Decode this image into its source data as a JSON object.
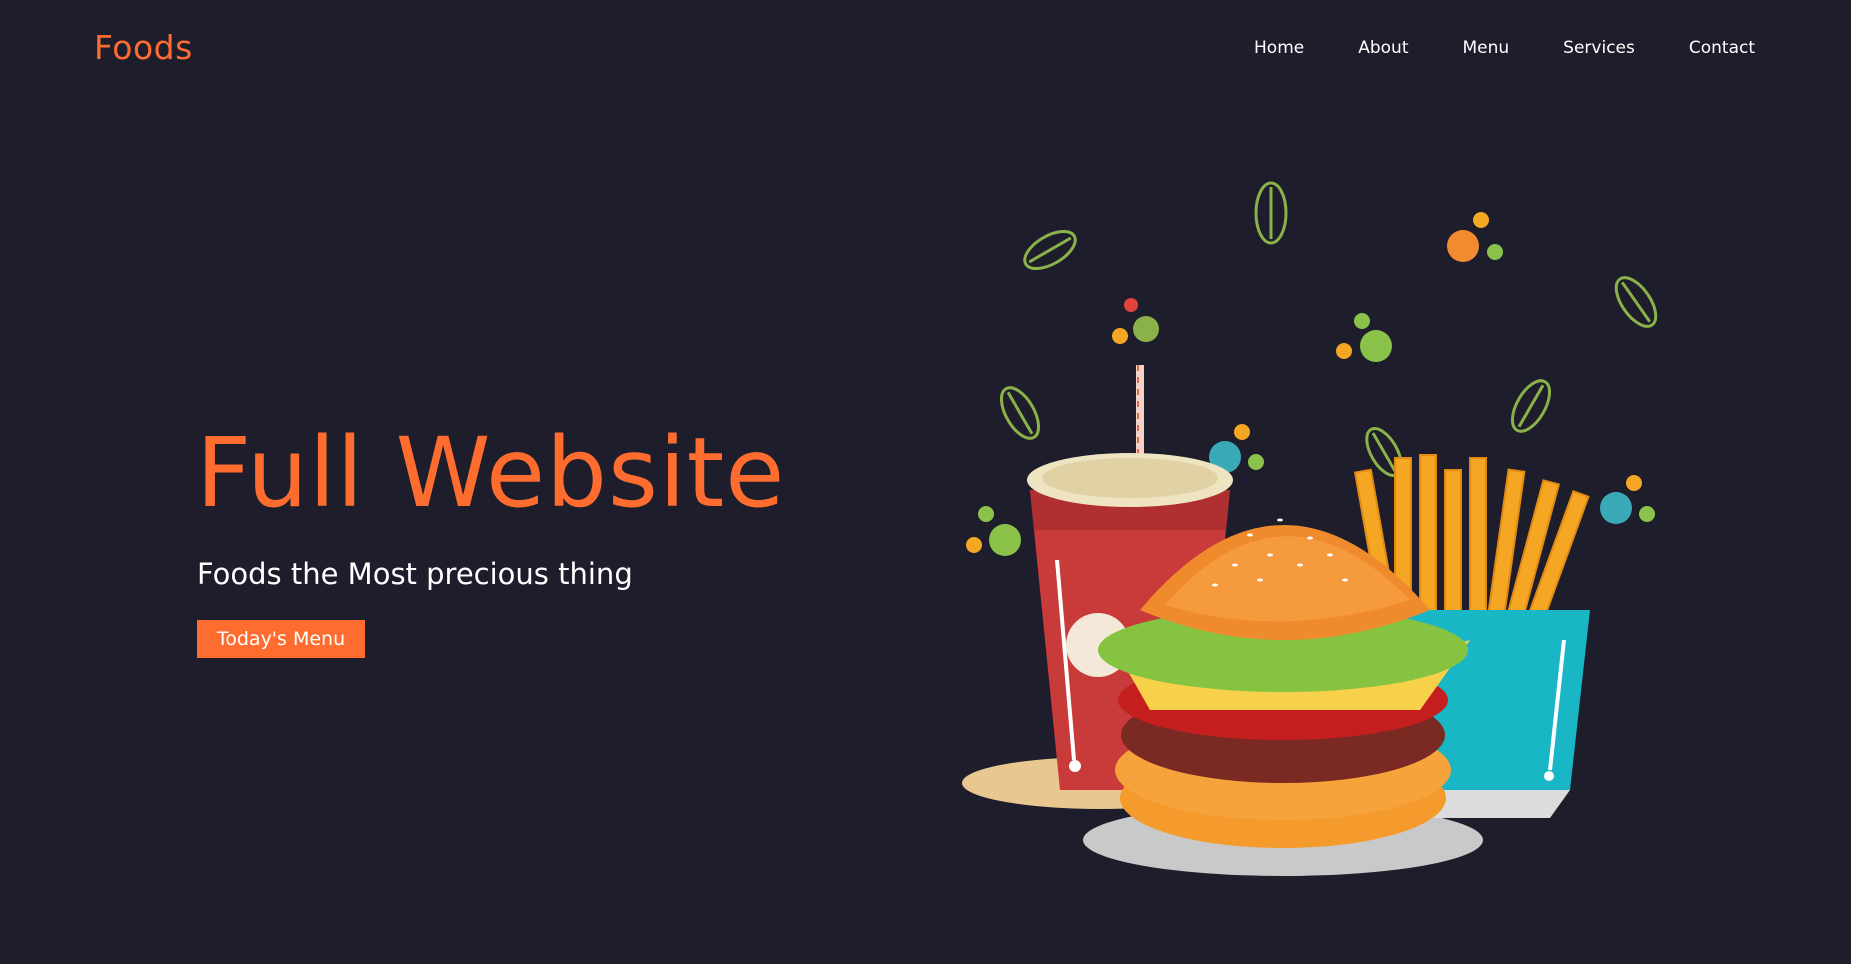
{
  "brand": {
    "name": "Foods"
  },
  "nav": {
    "items": [
      {
        "label": "Home"
      },
      {
        "label": "About"
      },
      {
        "label": "Menu"
      },
      {
        "label": "Services"
      },
      {
        "label": "Contact"
      }
    ]
  },
  "hero": {
    "title": "Full Website",
    "subtitle": "Foods the Most precious thing",
    "cta_label": "Today's Menu"
  },
  "colors": {
    "background": "#1e1d2b",
    "accent": "#ff6c2f",
    "text": "#ffffff"
  },
  "illustration": {
    "icons": [
      "leaf-icon",
      "soda-cup-icon",
      "burger-icon",
      "fries-icon",
      "bubble-dots-icon"
    ]
  }
}
